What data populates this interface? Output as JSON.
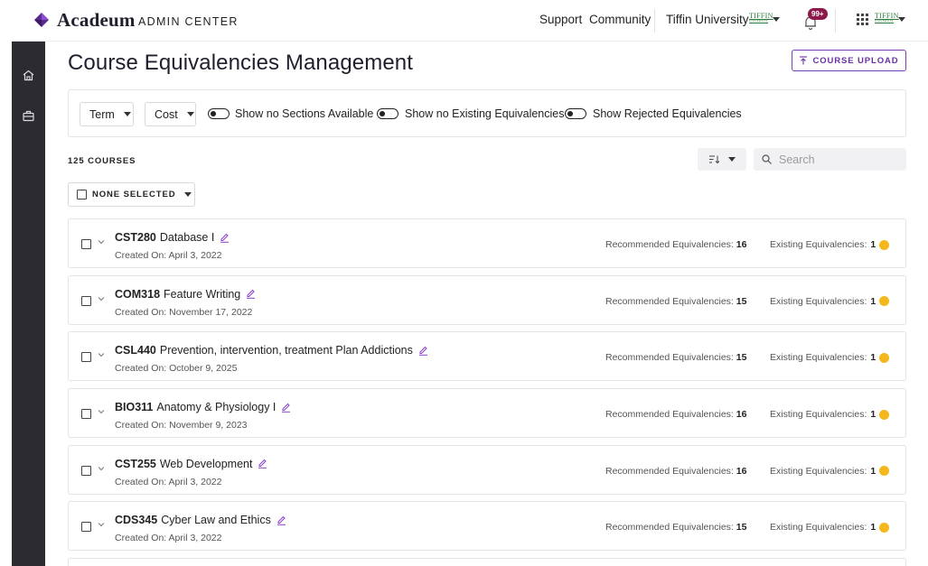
{
  "header": {
    "brand": "Acadeum",
    "subtitle": "ADMIN CENTER",
    "support": "Support",
    "community": "Community",
    "institution": "Tiffin University",
    "institution_logo_text": "TIFFIN",
    "institution_logo_sub": "UNIVERSITY",
    "notification_count": "99+"
  },
  "page": {
    "title": "Course Equivalencies Management",
    "upload_button": "COURSE UPLOAD"
  },
  "filters": {
    "term": "Term",
    "cost": "Cost",
    "toggle1": "Show no Sections Available",
    "toggle2": "Show no Existing Equivalencies",
    "toggle3": "Show Rejected Equivalencies"
  },
  "list": {
    "count": "125 COURSES",
    "search_placeholder": "Search",
    "selection": "NONE SELECTED"
  },
  "labels": {
    "recommended": "Recommended Equivalencies:",
    "existing": "Existing Equivalencies:"
  },
  "courses": [
    {
      "code": "CST280",
      "name": "Database I",
      "created": "Created On: April 3, 2022",
      "recommended": "16",
      "existing": "1"
    },
    {
      "code": "COM318",
      "name": "Feature Writing",
      "created": "Created On: November 17, 2022",
      "recommended": "15",
      "existing": "1"
    },
    {
      "code": "CSL440",
      "name": "Prevention, intervention, treatment Plan Addictions",
      "created": "Created On: October 9, 2025",
      "recommended": "15",
      "existing": "1"
    },
    {
      "code": "BIO311",
      "name": "Anatomy & Physiology I",
      "created": "Created On: November 9, 2023",
      "recommended": "16",
      "existing": "1"
    },
    {
      "code": "CST255",
      "name": "Web Development",
      "created": "Created On: April 3, 2022",
      "recommended": "16",
      "existing": "1"
    },
    {
      "code": "CDS345",
      "name": "Cyber Law and Ethics",
      "created": "Created On: April 3, 2022",
      "recommended": "15",
      "existing": "1"
    }
  ],
  "colors": {
    "accent": "#6b2fa3",
    "badge": "#8b1a4a",
    "warning_dot": "#f5b81c",
    "sidebar": "#2b2b30"
  },
  "icons": {
    "sidebar": [
      "home-icon",
      "briefcase-icon"
    ],
    "row": [
      "checkbox",
      "chevron-down-icon",
      "pencil-icon",
      "warning-dot"
    ]
  }
}
